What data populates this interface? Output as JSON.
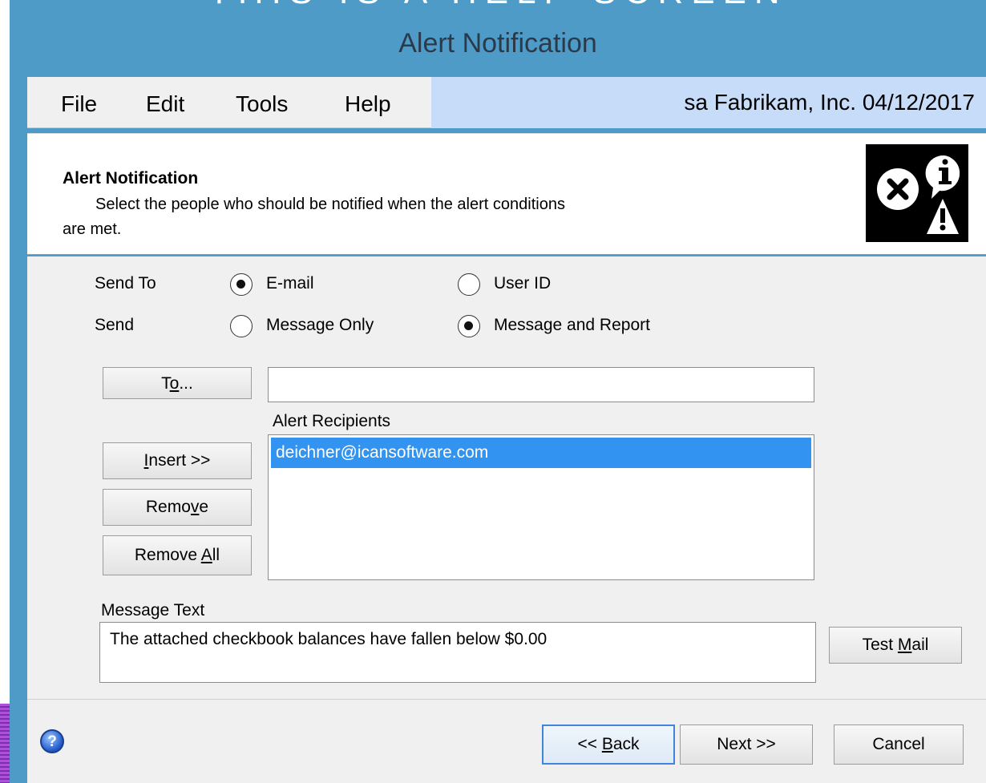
{
  "window": {
    "top_strip_text": "THIS IS A HELP SCREEN",
    "title": "Alert Notification"
  },
  "menu": {
    "items": [
      "File",
      "Edit",
      "Tools",
      "Help"
    ],
    "user_info": "sa  Fabrikam, Inc.  04/12/2017"
  },
  "header": {
    "title": "Alert Notification",
    "description_line1": "Select the people who should be notified when the alert conditions",
    "description_line2": "are met.",
    "icon": "alert-error-info-warning-icon"
  },
  "send_to": {
    "label": "Send To",
    "options": [
      {
        "label": "E-mail",
        "checked": true
      },
      {
        "label": "User ID",
        "checked": false
      }
    ]
  },
  "send": {
    "label": "Send",
    "options": [
      {
        "label": "Message Only",
        "checked": false
      },
      {
        "label": "Message and Report",
        "checked": true
      }
    ]
  },
  "buttons": {
    "to": {
      "pre": "T",
      "mnemonic": "o",
      "post": "..."
    },
    "insert": {
      "pre": "",
      "mnemonic": "I",
      "post": "nsert >>"
    },
    "remove": {
      "pre": "Remo",
      "mnemonic": "v",
      "post": "e"
    },
    "remove_all": {
      "pre": "Remove ",
      "mnemonic": "A",
      "post": "ll"
    },
    "test_mail": {
      "pre": "Test ",
      "mnemonic": "M",
      "post": "ail"
    },
    "back": {
      "pre": "<< ",
      "mnemonic": "B",
      "post": "ack"
    },
    "next": "Next >>",
    "cancel": "Cancel"
  },
  "to_input": {
    "value": ""
  },
  "recipients": {
    "label": "Alert Recipients",
    "items": [
      "deichner@icansoftware.com"
    ]
  },
  "message": {
    "label": "Message Text",
    "value": "The attached checkbook balances have fallen below $0.00"
  },
  "footer": {
    "help_icon": "help-question-icon",
    "help_glyph": "?"
  },
  "colors": {
    "frame": "#4f9bc8",
    "menu_right": "#c6dcf8",
    "selection": "#3294f0",
    "default_button_border": "#3f86d8"
  }
}
